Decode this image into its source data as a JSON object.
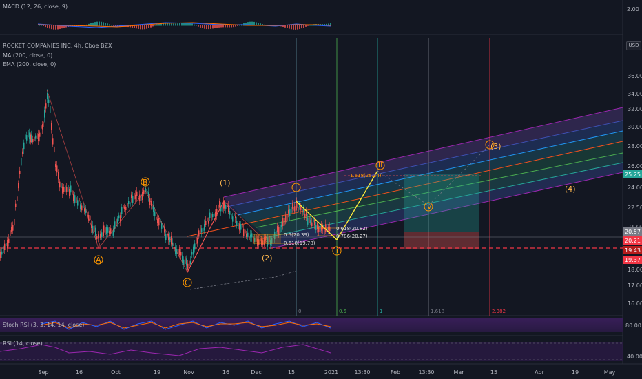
{
  "legends": {
    "macd": "MACD (12, 26, close, 9)",
    "main": "ROCKET COMPANIES INC, 4h, Cboe BZX",
    "ma": "MA (200, close, 0)",
    "ema": "EMA (200, close, 0)",
    "stoch": "Stoch RSI (3, 3, 14, 14, close)",
    "rsi": "RSI (14, close)"
  },
  "currency_button": "USD",
  "price_axis": [
    "36.00",
    "34.00",
    "32.00",
    "30.00",
    "28.00",
    "26.00",
    "24.00",
    "22.50",
    "21.00",
    "19.50",
    "18.00",
    "17.00",
    "16.00"
  ],
  "macd_axis": "2.00",
  "stoch_axis": "80.00",
  "rsi_axis": "40.00",
  "time_axis": [
    "Sep",
    "16",
    "Oct",
    "19",
    "Nov",
    "16",
    "Dec",
    "15",
    "2021",
    "13:30",
    "Feb",
    "13:30",
    "Mar",
    "15",
    "Apr",
    "19",
    "May"
  ],
  "price_tags": [
    {
      "text": "25.25",
      "color": "#26a69a"
    },
    {
      "text": "20.57",
      "color": "#787b86"
    },
    {
      "text": "20.21",
      "color": "#f23645"
    },
    {
      "text": "19.43",
      "color": "#b71c1c"
    },
    {
      "text": "19.37",
      "color": "#f23645"
    }
  ],
  "wave_labels": {
    "A": "A",
    "B": "B",
    "C": "C",
    "w1": "(1)",
    "w2": "(2)",
    "w3": "(3)",
    "w4": "(4)",
    "i": "i",
    "ii": "ii",
    "iii": "iii",
    "iv": "iv"
  },
  "fib_retracement": [
    "0.5(20.39)",
    "0.618(19.78)",
    "0.618(20.82)",
    "0.786(20.27)"
  ],
  "fib_extension": "1.618(25.24)",
  "fib_time": [
    "0",
    "0.5",
    "1",
    "1.618",
    "2.382"
  ],
  "colors": {
    "bull": "#26a69a",
    "bear": "#ef5350",
    "wave": "#ff9800",
    "accent": "#f23645"
  }
}
